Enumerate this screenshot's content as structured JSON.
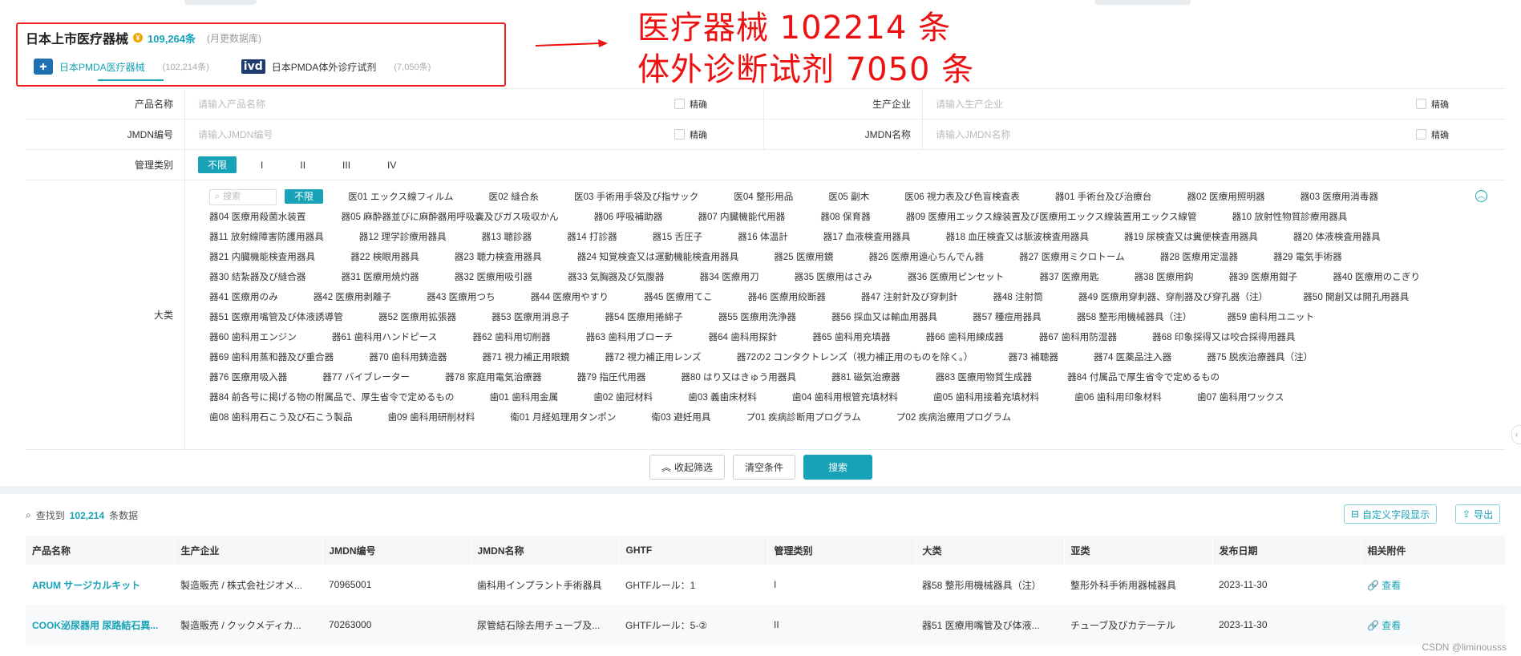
{
  "header": {
    "title": "日本上市医疗器械",
    "total": "109,264条",
    "update_note": "(月更数据库)"
  },
  "tabs": [
    {
      "label": "日本PMDA医疗器械",
      "count": "(102,214条)",
      "icon": "medical-device-icon"
    },
    {
      "label": "日本PMDA体外诊疗试剂",
      "count": "(7,050条)",
      "icon": "ivd-icon",
      "icon_text": "ivd"
    }
  ],
  "annotation": {
    "line1": "医疗器械  102214  条",
    "line2": "体外诊断试剂  7050  条",
    "color": "#e11111"
  },
  "filters": {
    "product_name_label": "产品名称",
    "product_name_placeholder": "请输入产品名称",
    "manufacturer_label": "生产企业",
    "manufacturer_placeholder": "请输入生产企业",
    "jmdn_code_label": "JMDN编号",
    "jmdn_code_placeholder": "请输入JMDN编号",
    "jmdn_name_label": "JMDN名称",
    "jmdn_name_placeholder": "请输入JMDN名称",
    "exact_label": "精确",
    "class_label": "管理类别",
    "class_options": [
      "不限",
      "I",
      "II",
      "III",
      "IV"
    ],
    "category_label": "大类",
    "category_search_placeholder": "搜索",
    "category_all": "不限",
    "categories": [
      "医01 エックス線フィルム",
      "医02 縫合糸",
      "医03 手術用手袋及び指サック",
      "医04 整形用品",
      "医05 副木",
      "医06 視力表及び色盲検査表",
      "器01 手術台及び治療台",
      "器02 医療用照明器",
      "器03 医療用消毒器",
      "器04 医療用殺菌水装置",
      "器05 麻酔器並びに麻酔器用呼吸嚢及びガス吸収かん",
      "器06 呼吸補助器",
      "器07 内臓機能代用器",
      "器08 保育器",
      "器09 医療用エックス線装置及び医療用エックス線装置用エックス線管",
      "器10 放射性物質診療用器具",
      "器11 放射線障害防護用器具",
      "器12 理学診療用器具",
      "器13 聴診器",
      "器14 打診器",
      "器15 舌圧子",
      "器16 体温計",
      "器17 血液検査用器具",
      "器18 血圧検査又は脈波検査用器具",
      "器19 尿検査又は糞便検査用器具",
      "器20 体液検査用器具",
      "器21 内臓機能検査用器具",
      "器22 検眼用器具",
      "器23 聴力検査用器具",
      "器24 知覚検査又は運動機能検査用器具",
      "器25 医療用鏡",
      "器26 医療用遠心ちんでん器",
      "器27 医療用ミクロトーム",
      "器28 医療用定温器",
      "器29 電気手術器",
      "器30 結紮器及び縫合器",
      "器31 医療用焼灼器",
      "器32 医療用吸引器",
      "器33 気胸器及び気腹器",
      "器34 医療用刀",
      "器35 医療用はさみ",
      "器36 医療用ピンセット",
      "器37 医療用匙",
      "器38 医療用鈎",
      "器39 医療用鉗子",
      "器40 医療用のこぎり",
      "器41 医療用のみ",
      "器42 医療用剥離子",
      "器43 医療用つち",
      "器44 医療用やすり",
      "器45 医療用てこ",
      "器46 医療用絞断器",
      "器47 注射針及び穿刺針",
      "器48 注射筒",
      "器49 医療用穿刺器、穿削器及び穿孔器（注）",
      "器50 開創又は開孔用器具",
      "器51 医療用嘴管及び体液誘導管",
      "器52 医療用拡張器",
      "器53 医療用消息子",
      "器54 医療用捲綿子",
      "器55 医療用洗浄器",
      "器56 採血又は輸血用器具",
      "器57 種痘用器具",
      "器58 整形用機械器具（注）",
      "器59 歯科用ユニット",
      "器60 歯科用エンジン",
      "器61 歯科用ハンドピース",
      "器62 歯科用切削器",
      "器63 歯科用ブローチ",
      "器64 歯科用探針",
      "器65 歯科用充填器",
      "器66 歯科用練成器",
      "器67 歯科用防湿器",
      "器68 印象採得又は咬合採得用器具",
      "器69 歯科用蒸和器及び重合器",
      "器70 歯科用鋳造器",
      "器71 視力補正用眼鏡",
      "器72 視力補正用レンズ",
      "器72の2 コンタクトレンズ（視力補正用のものを除く。）",
      "器73 補聴器",
      "器74 医薬品注入器",
      "器75 脱疾治療器具（注）",
      "器76 医療用吸入器",
      "器77 バイブレーター",
      "器78 家庭用電気治療器",
      "器79 指圧代用器",
      "器80 はり又はきゅう用器具",
      "器81 磁気治療器",
      "器83 医療用物質生成器",
      "器84 付属品で厚生省令で定めるもの",
      "器84 前各号に掲げる物の附属品で、厚生省令で定めるもの",
      "歯01 歯科用金属",
      "歯02 歯冠材料",
      "歯03 義歯床材料",
      "歯04 歯科用根管充填材料",
      "歯05 歯科用接着充填材料",
      "歯06 歯科用印象材料",
      "歯07 歯科用ワックス",
      "歯08 歯科用石こう及び石こう製品",
      "歯09 歯科用研削材料",
      "衛01 月経処理用タンポン",
      "衛03 避妊用具",
      "プ01 疾病診断用プログラム",
      "プ02 疾病治療用プログラム"
    ]
  },
  "actions": {
    "collapse": "收起筛选",
    "clear": "清空条件",
    "search": "搜索"
  },
  "results": {
    "found_prefix": "查找到",
    "found_count": "102,214",
    "found_suffix": "条数据",
    "custom_fields": "自定义字段显示",
    "export": "导出",
    "columns": [
      "产品名称",
      "生产企业",
      "JMDN编号",
      "JMDN名称",
      "GHTF",
      "管理类别",
      "大类",
      "亚类",
      "发布日期",
      "相关附件"
    ],
    "rows": [
      [
        "ARUM サージカルキット",
        "製造販売 / 株式会社ジオメ...",
        "70965001",
        "歯科用インプラント手術器具",
        "GHTFルール：1",
        "I",
        "器58 整形用機械器具（注）",
        "整形外科手術用器械器具",
        "2023-11-30",
        "查看"
      ],
      [
        "COOK泌尿器用 尿路結石異...",
        "製造販売 / クックメディカ...",
        "70263000",
        "尿管結石除去用チューブ及...",
        "GHTFルール：5-②",
        "II",
        "器51 医療用嘴管及び体液...",
        "チューブ及びカテーテル",
        "2023-11-30",
        "查看"
      ]
    ]
  },
  "watermark": "CSDN @liminousss"
}
